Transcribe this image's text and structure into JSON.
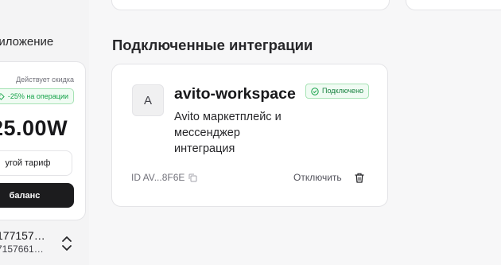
{
  "sidebar": {
    "title": "риложение",
    "plan": {
      "discount_label": "Действует скидка",
      "discount_badge": "-25% на операции",
      "price": "25.00W",
      "other_plan_button": "угой тариф",
      "balance_button": "баланс"
    },
    "account": {
      "line1": "177157…",
      "line2": "7157661…",
      "chevron_icon": "chevron-up-down-icon"
    }
  },
  "main": {
    "section_title": "Подключенные интеграции",
    "integration": {
      "avatar_letter": "A",
      "name": "avito-workspace",
      "status": "Подключено",
      "description": "Avito маркетплейс и мессенджер интеграция",
      "id": "ID AV...8F6E",
      "disconnect": "Отключить",
      "icons": [
        "check-circle-icon",
        "copy-icon",
        "trash-icon",
        "tag-icon"
      ]
    }
  },
  "colors": {
    "accent_green": "#16a34a",
    "dark_button": "#1c1c1e",
    "background": "#f7f7f8"
  }
}
